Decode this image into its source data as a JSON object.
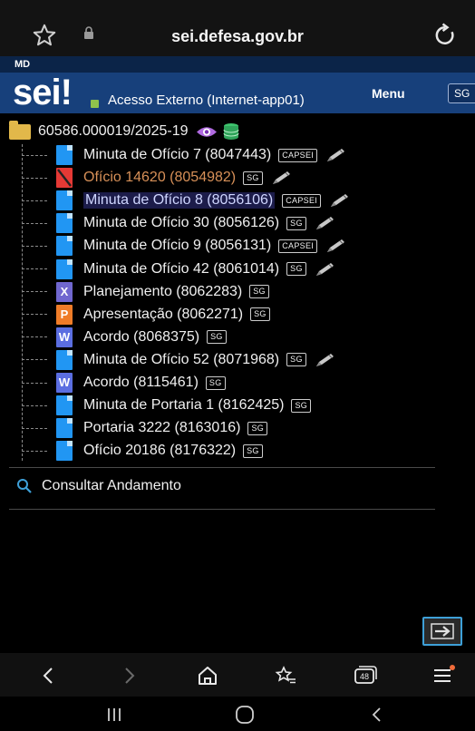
{
  "browser": {
    "domain": "sei.defesa.gov.br",
    "tab_count": "48"
  },
  "header": {
    "strip_label": "MD",
    "logo": "sei",
    "logo_bang": "!",
    "subtitle": "Acesso Externo (Internet-app01)",
    "menu_label": "Menu",
    "unit_label": "SG"
  },
  "tree": {
    "root_label": "60586.000019/2025-19",
    "items": [
      {
        "icon": "doc-blue-icon",
        "label": "Minuta de Ofício 7 (8047443)",
        "badge": "CAPSEI",
        "signed": true,
        "state": "normal"
      },
      {
        "icon": "doc-cancelled-icon",
        "label": "Ofício 14620 (8054982)",
        "badge": "SG",
        "signed": true,
        "state": "cancelled"
      },
      {
        "icon": "doc-blue-icon",
        "label": "Minuta de Ofício 8 (8056106)",
        "badge": "CAPSEI",
        "signed": true,
        "state": "selected"
      },
      {
        "icon": "doc-blue-icon",
        "label": "Minuta de Ofício 30 (8056126)",
        "badge": "SG",
        "signed": true,
        "state": "normal"
      },
      {
        "icon": "doc-blue-icon",
        "label": "Minuta de Ofício 9 (8056131)",
        "badge": "CAPSEI",
        "signed": true,
        "state": "normal"
      },
      {
        "icon": "doc-blue-icon",
        "label": "Minuta de Ofício 42 (8061014)",
        "badge": "SG",
        "signed": true,
        "state": "normal"
      },
      {
        "icon": "excel-icon",
        "label": "Planejamento (8062283)",
        "badge": "SG",
        "signed": false,
        "state": "normal"
      },
      {
        "icon": "powerpoint-icon",
        "label": "Apresentação (8062271)",
        "badge": "SG",
        "signed": false,
        "state": "normal"
      },
      {
        "icon": "word-icon",
        "label": "Acordo (8068375)",
        "badge": "SG",
        "signed": false,
        "state": "normal"
      },
      {
        "icon": "doc-blue-icon",
        "label": "Minuta de Ofício 52 (8071968)",
        "badge": "SG",
        "signed": true,
        "state": "normal"
      },
      {
        "icon": "word-icon",
        "label": "Acordo (8115461)",
        "badge": "SG",
        "signed": false,
        "state": "normal"
      },
      {
        "icon": "doc-blue-icon",
        "label": "Minuta de Portaria 1 (8162425)",
        "badge": "SG",
        "signed": false,
        "state": "normal"
      },
      {
        "icon": "doc-blue-icon",
        "label": "Portaria 3222 (8163016)",
        "badge": "SG",
        "signed": false,
        "state": "normal"
      },
      {
        "icon": "doc-blue-icon",
        "label": "Ofício 20186 (8176322)",
        "badge": "SG",
        "signed": false,
        "state": "normal"
      }
    ]
  },
  "actions": {
    "consult_label": "Consultar Andamento"
  }
}
